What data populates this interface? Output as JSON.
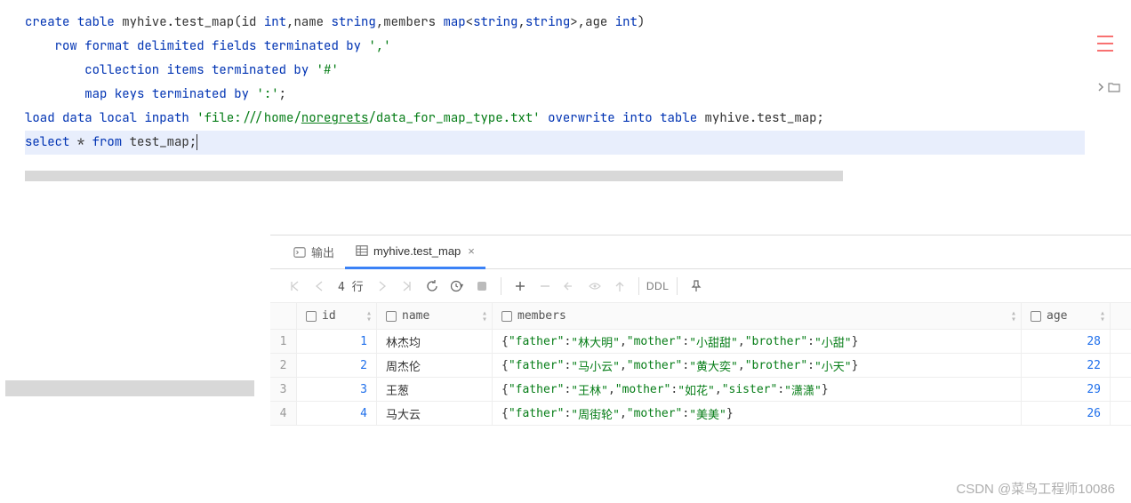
{
  "editor": {
    "l1": {
      "kw1": "create",
      "kw2": "table",
      "ident": " myhive.test_map(",
      "c1": "id ",
      "t1": "int",
      "p1": ",",
      "c2": "name ",
      "t2": "string",
      "p2": ",",
      "c3": "members ",
      "t3": "map",
      "p3": "<",
      "t4": "string",
      "p4": ",",
      "t5": "string",
      "p5": ">,",
      "c4": "age ",
      "t6": "int",
      "p6": ")"
    },
    "l2": {
      "indent": "    ",
      "kw1": "row",
      "kw2": "format",
      "kw3": "delimited",
      "kw4": "fields",
      "kw5": "terminated",
      "kw6": "by",
      "str": "','"
    },
    "l3": {
      "indent": "        ",
      "kw1": "collection",
      "kw2": "items",
      "kw3": "terminated",
      "kw4": "by",
      "str": "'#'"
    },
    "l4": {
      "indent": "        ",
      "kw1": "map",
      "kw2": "keys",
      "kw3": "terminated",
      "kw4": "by",
      "str": "':'",
      "semi": ";"
    },
    "l5": {
      "kw1": "load",
      "kw2": "data",
      "kw3": "local",
      "kw4": "inpath",
      "q1": "'",
      "link1": "file:///home/",
      "link2": "noregrets",
      "link3": "/data_for_map_type.txt",
      "q2": "'",
      "kw5": "overwrite",
      "kw6": "into",
      "kw7": "table",
      "ident": " myhive.test_map;",
      "sp": " "
    },
    "l6": {
      "kw1": "select",
      "star": " * ",
      "kw2": "from",
      "ident": " test_map;"
    }
  },
  "tabs": {
    "output": "输出",
    "table": "myhive.test_map"
  },
  "toolbar": {
    "rows": "4 行",
    "ddl": "DDL"
  },
  "grid": {
    "headers": {
      "id": "id",
      "name": "name",
      "members": "members",
      "age": "age"
    },
    "rows": [
      {
        "n": "1",
        "id": "1",
        "name": "林杰均",
        "members": [
          [
            "father",
            "林大明"
          ],
          [
            "mother",
            "小甜甜"
          ],
          [
            "brother",
            "小甜"
          ]
        ],
        "age": "28"
      },
      {
        "n": "2",
        "id": "2",
        "name": "周杰伦",
        "members": [
          [
            "father",
            "马小云"
          ],
          [
            "mother",
            "黄大奕"
          ],
          [
            "brother",
            "小天"
          ]
        ],
        "age": "22"
      },
      {
        "n": "3",
        "id": "3",
        "name": "王葱",
        "members": [
          [
            "father",
            "王林"
          ],
          [
            "mother",
            "如花"
          ],
          [
            "sister",
            "潇潇"
          ]
        ],
        "age": "29"
      },
      {
        "n": "4",
        "id": "4",
        "name": "马大云",
        "members": [
          [
            "father",
            "周街轮"
          ],
          [
            "mother",
            "美美"
          ]
        ],
        "age": "26"
      }
    ]
  },
  "watermark": "CSDN @菜鸟工程师10086"
}
